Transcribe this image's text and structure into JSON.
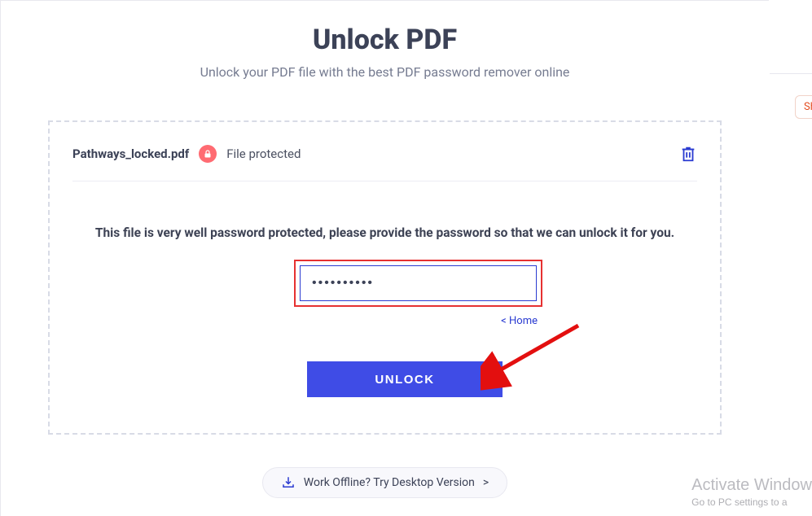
{
  "header": {
    "title": "Unlock PDF",
    "subtitle": "Unlock your PDF file with the best PDF password remover online"
  },
  "file": {
    "name": "Pathways_locked.pdf",
    "status": "File protected"
  },
  "prompt": "This file is very well password protected, please provide the password so that we can unlock it for you.",
  "password": {
    "value": "••••••••••"
  },
  "links": {
    "home": "< Home"
  },
  "buttons": {
    "unlock": "UNLOCK"
  },
  "offline": {
    "text": "Work Offline? Try Desktop Version",
    "chevron": ">"
  },
  "share_chip": "Sh",
  "watermark": {
    "line1": "Activate Window",
    "line2": "Go to PC settings to a"
  }
}
